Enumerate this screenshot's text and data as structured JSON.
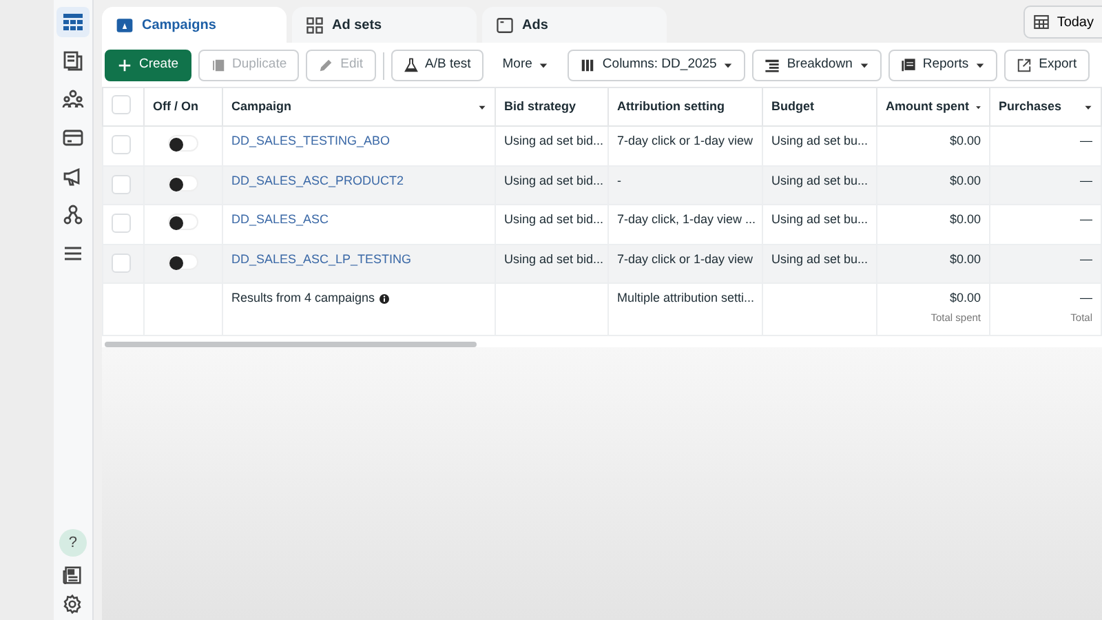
{
  "sidebar": {
    "items": [
      {
        "selected": true
      },
      {
        "selected": false
      },
      {
        "selected": false
      },
      {
        "selected": false
      },
      {
        "selected": false
      },
      {
        "selected": false
      },
      {
        "selected": false
      }
    ],
    "bottom": [
      {
        "kind": "help",
        "label": "?"
      },
      {
        "kind": "news"
      },
      {
        "kind": "settings"
      }
    ]
  },
  "tabs": [
    {
      "label": "Campaigns",
      "selected": true
    },
    {
      "label": "Ad sets",
      "selected": false
    },
    {
      "label": "Ads",
      "selected": false
    }
  ],
  "date_button": {
    "label": "Today"
  },
  "toolbar": [
    {
      "kind": "create",
      "label": "Create",
      "disabled": false
    },
    {
      "kind": "duplicate",
      "label": "Duplicate",
      "disabled": true
    },
    {
      "kind": "edit",
      "label": "Edit",
      "disabled": true
    },
    {
      "kind": "abtest",
      "label": "A/B test",
      "disabled": false
    },
    {
      "kind": "more",
      "label": "More",
      "disabled": false
    },
    {
      "kind": "columns",
      "label": "Columns: DD_2025",
      "disabled": false
    },
    {
      "kind": "breakdown",
      "label": "Breakdown",
      "disabled": false
    },
    {
      "kind": "reports",
      "label": "Reports",
      "disabled": false
    },
    {
      "kind": "export",
      "label": "Export",
      "disabled": false
    }
  ],
  "table": {
    "columns": [
      {
        "kind": "checkbox",
        "checked": false
      },
      {
        "label": "Off / On",
        "dropdown": false
      },
      {
        "label": "Campaign",
        "dropdown": true
      },
      {
        "label": "Bid strategy",
        "dropdown": false
      },
      {
        "label": "Attribution setting",
        "dropdown": false
      },
      {
        "label": "Budget",
        "dropdown": false
      },
      {
        "label": "Amount spent",
        "dropdown": true
      },
      {
        "label": "Purchases",
        "dropdown": true
      }
    ],
    "rows": [
      {
        "selected": false,
        "on": false,
        "cells": [
          "",
          "",
          "DD_SALES_TESTING_ABO",
          "Using ad set bid...",
          "7-day click or 1-day view",
          "Using ad set bu...",
          "$0.00",
          "—"
        ]
      },
      {
        "selected": false,
        "on": false,
        "cells": [
          "",
          "",
          "DD_SALES_ASC_PRODUCT2",
          "Using ad set bid...",
          "-",
          "Using ad set bu...",
          "$0.00",
          "—"
        ]
      },
      {
        "selected": false,
        "on": false,
        "cells": [
          "",
          "",
          "DD_SALES_ASC",
          "Using ad set bid...",
          "7-day click, 1-day view ...",
          "Using ad set bu...",
          "$0.00",
          "—"
        ]
      },
      {
        "selected": false,
        "on": false,
        "cells": [
          "",
          "",
          "DD_SALES_ASC_LP_TESTING",
          "Using ad set bid...",
          "7-day click or 1-day view",
          "Using ad set bu...",
          "$0.00",
          "—"
        ]
      }
    ],
    "summary": {
      "label": "Results from 4 campaigns",
      "attribution": "Multiple attribution setti...",
      "amount": "$0.00",
      "amount_note": "Total spent",
      "purchases": "—",
      "purchases_note": "Total"
    }
  }
}
